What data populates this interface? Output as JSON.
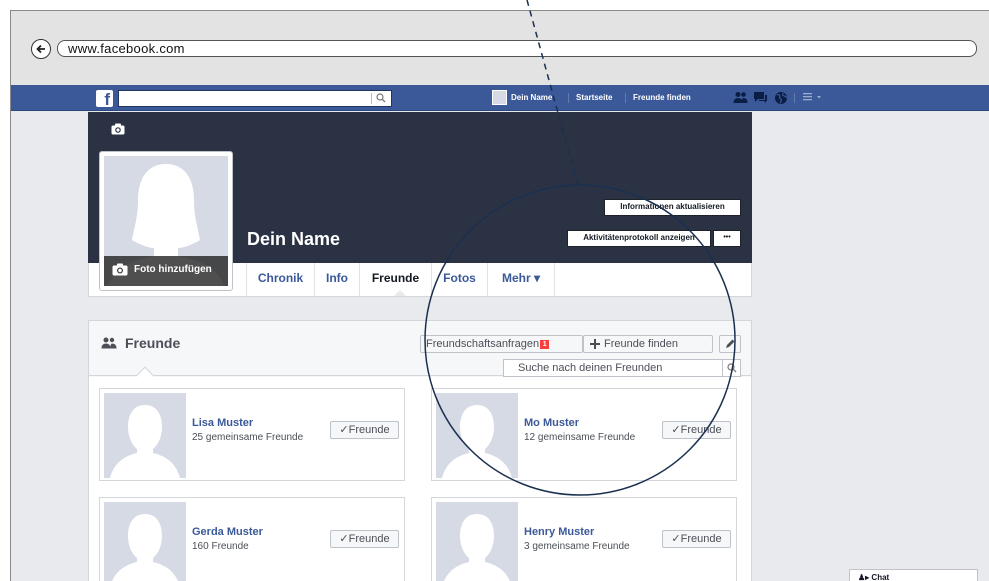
{
  "browser": {
    "url": "www.facebook.com"
  },
  "fb_header": {
    "logo": "f",
    "user_name": "Dein Name",
    "links": [
      "Startseite",
      "Freunde finden"
    ],
    "icons": [
      "friend-requests-icon",
      "messages-icon",
      "notifications-globe-icon",
      "settings-menu-icon"
    ]
  },
  "profile": {
    "name": "Dein Name",
    "add_photo_label": "Foto hinzufügen",
    "update_info_label": "Informationen aktualisieren",
    "activity_log_label": "Aktivitätenprotokoll anzeigen",
    "more_label": "•••",
    "tabs": [
      {
        "label": "Chronik"
      },
      {
        "label": "Info"
      },
      {
        "label": "Freunde"
      },
      {
        "label": "Fotos"
      },
      {
        "label": "Mehr ▾"
      }
    ],
    "active_tab": "Freunde"
  },
  "friends_panel": {
    "title": "Freunde",
    "requests_label": "Freundschaftsanfragen",
    "requests_badge": "1",
    "find_friends_label": "Freunde finden",
    "search_placeholder": "Suche nach deinen Freunden",
    "friends": [
      {
        "name": "Lisa Muster",
        "subtitle": "25 gemeinsame Freunde",
        "button": "Freunde"
      },
      {
        "name": "Mo Muster",
        "subtitle": "12 gemeinsame Freunde",
        "button": "Freunde"
      },
      {
        "name": "Gerda Muster",
        "subtitle": "160 Freunde",
        "button": "Freunde"
      },
      {
        "name": "Henry Muster",
        "subtitle": "3 gemeinsame Freunde",
        "button": "Freunde"
      }
    ]
  },
  "chat": {
    "label": "Chat"
  },
  "colors": {
    "facebook_blue": "#3b5998",
    "cover_dark": "#2b3244",
    "annotation_line": "#1a3050",
    "placeholder_silhouette": "#d6dae5"
  }
}
